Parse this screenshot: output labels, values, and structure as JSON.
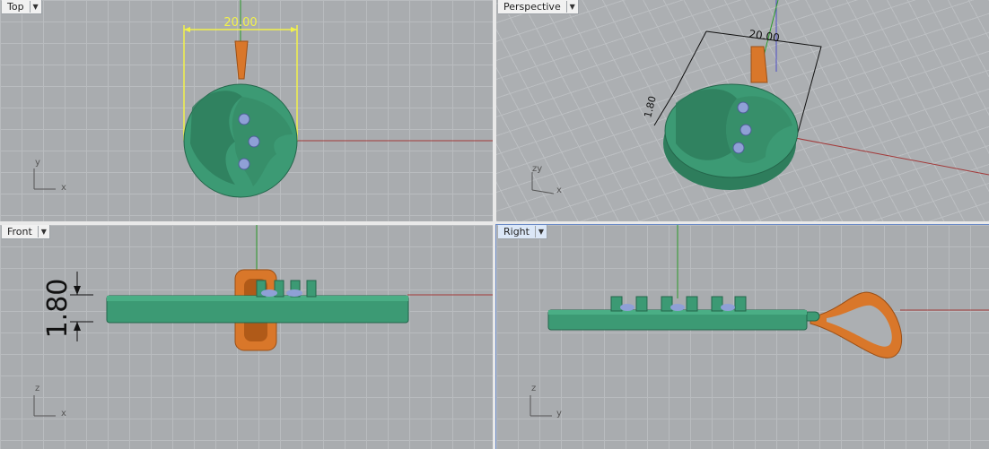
{
  "viewports": {
    "top": {
      "label": "Top",
      "dimension": "20.00",
      "axis_v": "y",
      "axis_h": "x"
    },
    "perspective": {
      "label": "Perspective",
      "dimension_w": "20.00",
      "dimension_h": "1.80",
      "axis_v": "zy",
      "axis_h": "x"
    },
    "front": {
      "label": "Front",
      "dimension": "1.80",
      "axis_v": "z",
      "axis_h": "x"
    },
    "right": {
      "label": "Right",
      "axis_v": "z",
      "axis_h": "y"
    }
  },
  "colors": {
    "pendant": "#3c9a74",
    "bail": "#d9772a",
    "gems": "#8fa0d6",
    "dimension_yellow": "#f2f24a",
    "x_axis": "#a33a3a",
    "y_axis": "#2a9a2a",
    "z_axis": "#4c4cc5"
  }
}
